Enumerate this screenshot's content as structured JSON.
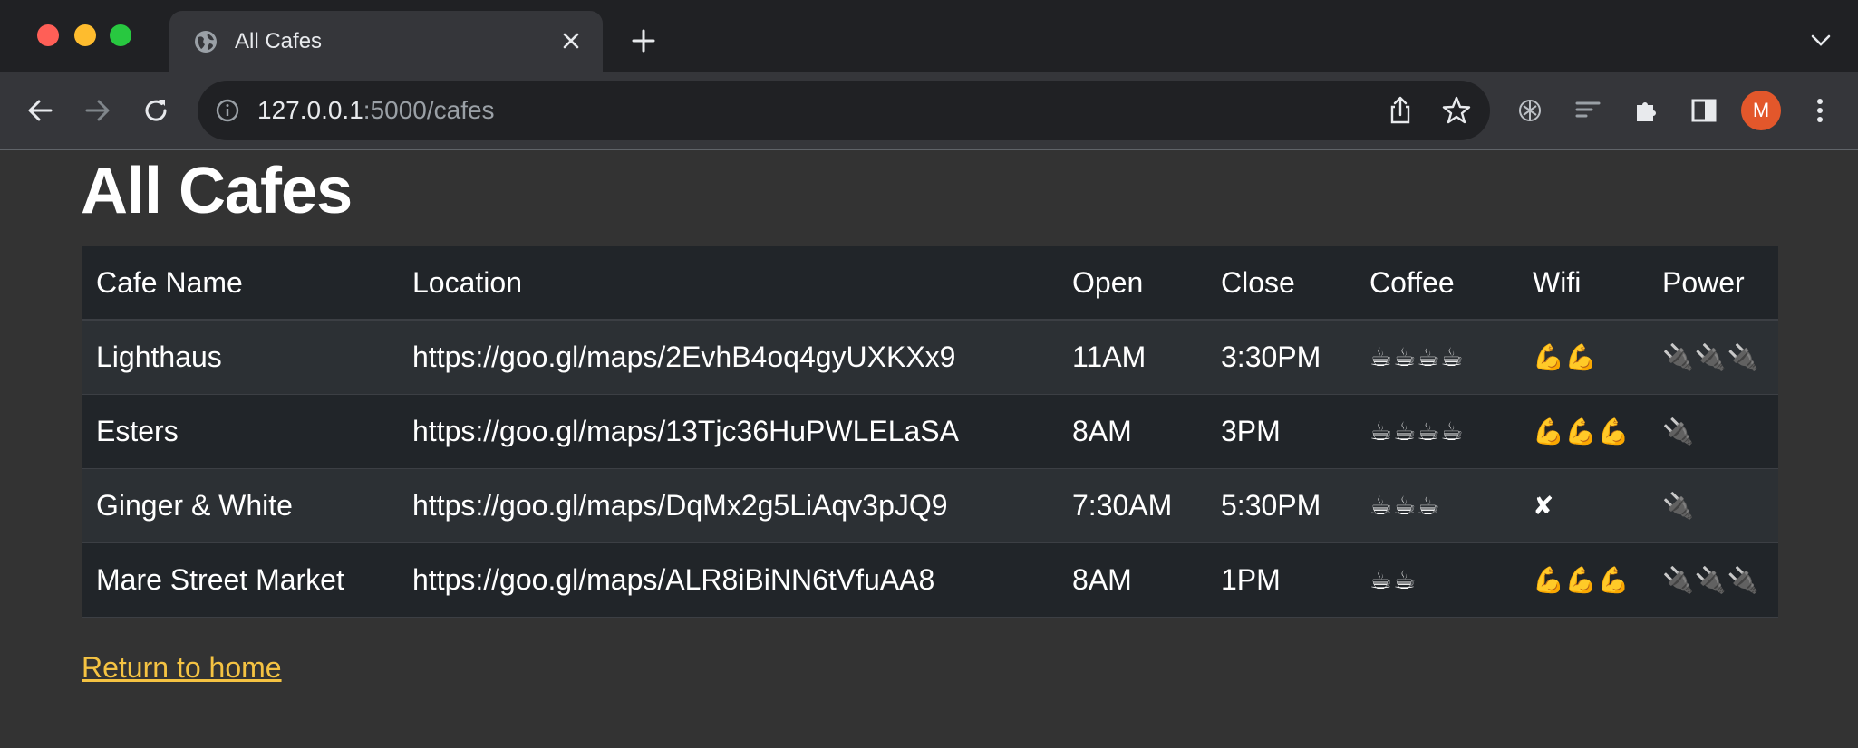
{
  "browser": {
    "tab": {
      "title": "All Cafes"
    },
    "address": {
      "host": "127.0.0.1",
      "path": ":5000/cafes"
    },
    "profile_initial": "M"
  },
  "page": {
    "title": "All Cafes",
    "table": {
      "headers": [
        "Cafe Name",
        "Location",
        "Open",
        "Close",
        "Coffee",
        "Wifi",
        "Power"
      ],
      "rows": [
        {
          "name": "Lighthaus",
          "location": "https://goo.gl/maps/2EvhB4oq4gyUXKXx9",
          "open": "11AM",
          "close": "3:30PM",
          "coffee": "☕☕☕☕",
          "wifi": "💪💪",
          "power": "🔌🔌🔌"
        },
        {
          "name": "Esters",
          "location": "https://goo.gl/maps/13Tjc36HuPWLELaSA",
          "open": "8AM",
          "close": "3PM",
          "coffee": "☕☕☕☕",
          "wifi": "💪💪💪",
          "power": "🔌"
        },
        {
          "name": "Ginger & White",
          "location": "https://goo.gl/maps/DqMx2g5LiAqv3pJQ9",
          "open": "7:30AM",
          "close": "5:30PM",
          "coffee": "☕☕☕",
          "wifi": "✘",
          "power": "🔌"
        },
        {
          "name": "Mare Street Market",
          "location": "https://goo.gl/maps/ALR8iBiNN6tVfuAA8",
          "open": "8AM",
          "close": "1PM",
          "coffee": "☕☕",
          "wifi": "💪💪💪",
          "power": "🔌🔌🔌"
        }
      ]
    },
    "home_link": "Return to home"
  },
  "colors": {
    "link": "#f5c342",
    "avatar": "#e3572b",
    "page_bg": "#333333"
  }
}
